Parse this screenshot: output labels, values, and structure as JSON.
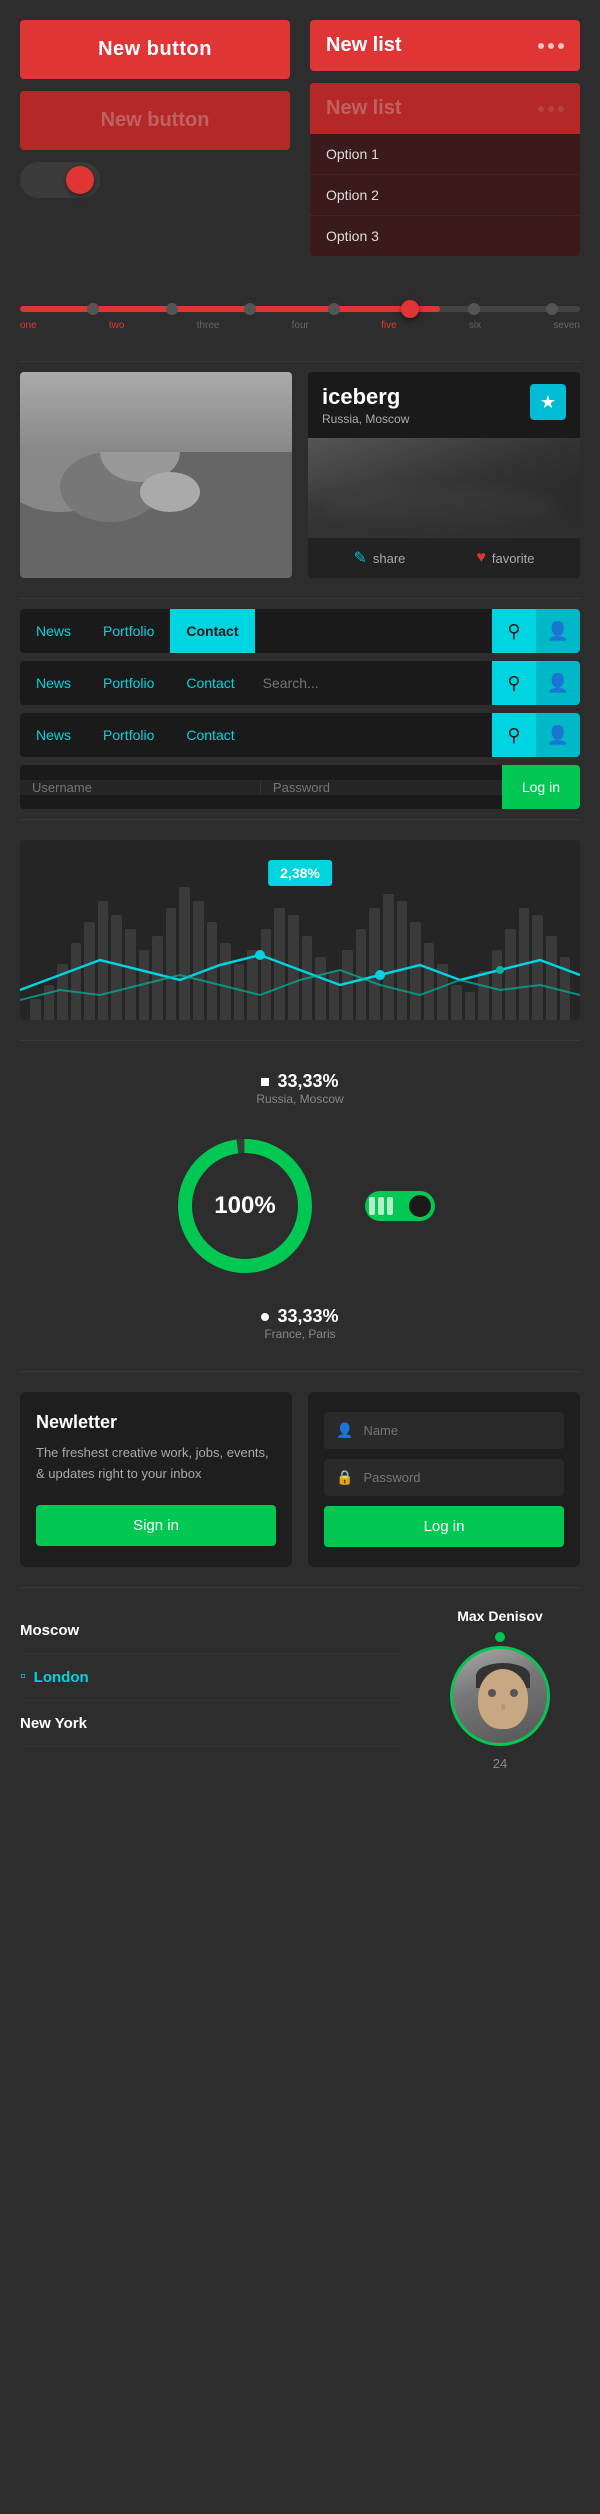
{
  "buttons": {
    "btn1_label": "New button",
    "btn2_label": "New button",
    "list1_title": "New list",
    "list2_title": "New list",
    "option1": "Option 1",
    "option2": "Option 2",
    "option3": "Option 3"
  },
  "slider": {
    "labels": [
      "one",
      "two",
      "three",
      "four",
      "five",
      "six",
      "seven"
    ]
  },
  "card": {
    "title": "iceberg",
    "subtitle": "Russia, Moscow",
    "share_label": "share",
    "favorite_label": "favorite"
  },
  "nav": {
    "item1": "News",
    "item2": "Portfolio",
    "item3": "Contact",
    "search_placeholder": "Search...",
    "login_label": "Log in",
    "username_placeholder": "Username",
    "password_placeholder": "Password"
  },
  "chart": {
    "percent": "2,38%",
    "bars": [
      20,
      40,
      60,
      80,
      100,
      120,
      90,
      70,
      50,
      80,
      110,
      130,
      100,
      80,
      60,
      40,
      70,
      90,
      110,
      100,
      80,
      60,
      50,
      70,
      90,
      110,
      130,
      120,
      100,
      80,
      60,
      40,
      30,
      50,
      70,
      90,
      110,
      100,
      80,
      60
    ]
  },
  "donut": {
    "center_label": "100%",
    "top_percent": "33,33%",
    "top_location": "Russia, Moscow",
    "bottom_percent": "33,33%",
    "bottom_location": "France, Paris"
  },
  "newsletter": {
    "title": "Newletter",
    "text": "The freshest creative work, jobs, events, & updates right to your inbox",
    "signin_label": "Sign in",
    "name_placeholder": "Name",
    "password_placeholder": "Password",
    "login_label": "Log in"
  },
  "profile": {
    "locations": [
      "Moscow",
      "London",
      "New York"
    ],
    "name": "Max Denisov",
    "age": "24"
  }
}
